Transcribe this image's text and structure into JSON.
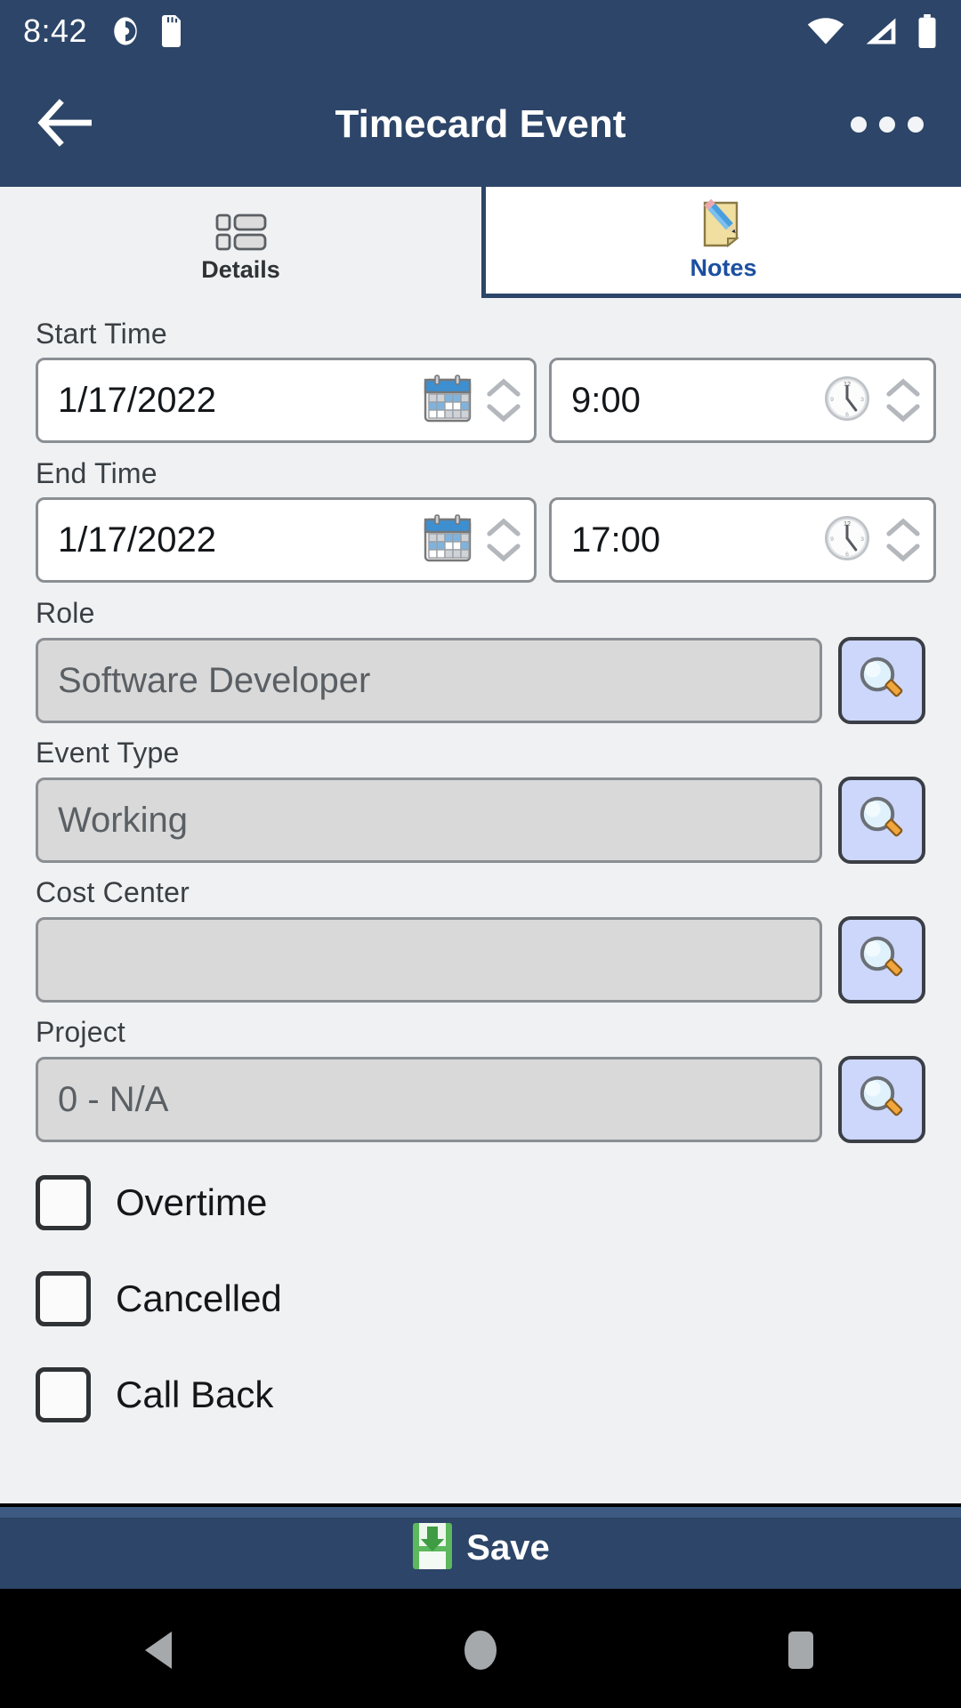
{
  "status_bar": {
    "time": "8:42",
    "left_icons": [
      "screenshot-icon",
      "sd-card-icon"
    ],
    "right_icons": [
      "wifi-icon",
      "cellular-signal-icon",
      "battery-icon"
    ]
  },
  "app_bar": {
    "back_icon": "back-arrow-icon",
    "title": "Timecard Event",
    "overflow_icon": "overflow-menu-icon"
  },
  "tabs": [
    {
      "label": "Details",
      "icon": "details-list-icon",
      "active": false
    },
    {
      "label": "Notes",
      "icon": "note-pencil-icon",
      "active": true
    }
  ],
  "form": {
    "start_time": {
      "label": "Start Time",
      "date_value": "1/17/2022",
      "date_icon": "calendar-icon",
      "time_value": "9:00",
      "time_icon": "clock-icon",
      "spinner_icon": "spinner-up-down-icon"
    },
    "end_time": {
      "label": "End Time",
      "date_value": "1/17/2022",
      "date_icon": "calendar-icon",
      "time_value": "17:00",
      "time_icon": "clock-icon",
      "spinner_icon": "spinner-up-down-icon"
    },
    "role": {
      "label": "Role",
      "value": "Software Developer",
      "lookup_icon": "magnifier-icon"
    },
    "event_type": {
      "label": "Event Type",
      "value": "Working",
      "lookup_icon": "magnifier-icon"
    },
    "cost_center": {
      "label": "Cost Center",
      "value": "",
      "lookup_icon": "magnifier-icon"
    },
    "project": {
      "label": "Project",
      "value": "0 - N/A",
      "lookup_icon": "magnifier-icon"
    },
    "checkboxes": [
      {
        "label": "Overtime",
        "checked": false
      },
      {
        "label": "Cancelled",
        "checked": false
      },
      {
        "label": "Call Back",
        "checked": false
      }
    ]
  },
  "footer": {
    "save_label": "Save",
    "save_icon": "save-disk-icon"
  },
  "nav_bar": {
    "back": "android-back-icon",
    "home": "android-home-icon",
    "recents": "android-recents-icon"
  },
  "colors": {
    "header_blue": "#2c4568",
    "page_bg": "#eff1f3",
    "tab_active_text": "#1b4fa0",
    "lookup_button_bg": "#ccd7fb",
    "disabled_field_bg": "#d9d9d9",
    "save_icon_green": "#4caf50"
  }
}
